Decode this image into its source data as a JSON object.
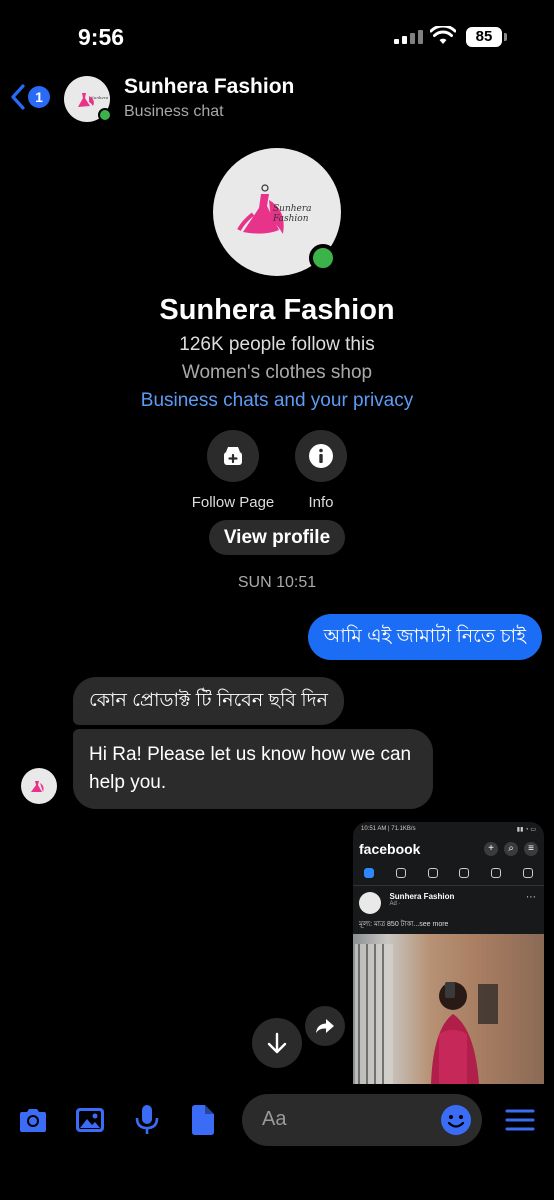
{
  "status_bar": {
    "time": "9:56",
    "battery": "85"
  },
  "header": {
    "back_count": "1",
    "title": "Sunhera Fashion",
    "subtitle": "Business chat"
  },
  "profile": {
    "name": "Sunhera Fashion",
    "followers": "126K people follow this",
    "category": "Women's clothes shop",
    "privacy_link": "Business chats and your privacy",
    "logo_text": "Sunhera Fashion",
    "actions": [
      {
        "label": "Follow Page",
        "icon": "follow-page-icon"
      },
      {
        "label": "Info",
        "icon": "info-icon"
      }
    ],
    "view_profile": "View profile"
  },
  "thread": {
    "timestamp": "SUN 10:51",
    "messages": [
      {
        "from": "me",
        "text": "আমি এই জামাটা নিতে চাই"
      },
      {
        "from": "business",
        "text": "কোন প্রোডাক্ট টি নিবেন  ছবি দিন"
      },
      {
        "from": "business",
        "text": "Hi Ra! Please let us know how we can help you."
      }
    ],
    "shared_image": {
      "status_time": "10:51 AM | 71.1KB/s",
      "app_name": "facebook",
      "post_author": "Sunhera Fashion",
      "post_meta": "Ad · ",
      "post_text": "মূল্য: মাত্র 850 টাকা...see more"
    }
  },
  "composer": {
    "placeholder": "Aa"
  },
  "colors": {
    "accent": "#1b6df5",
    "link": "#5b9cf6",
    "bubble_in": "#2b2b2b",
    "icon_blue": "#3b6cf6",
    "online": "#3bb34a"
  }
}
